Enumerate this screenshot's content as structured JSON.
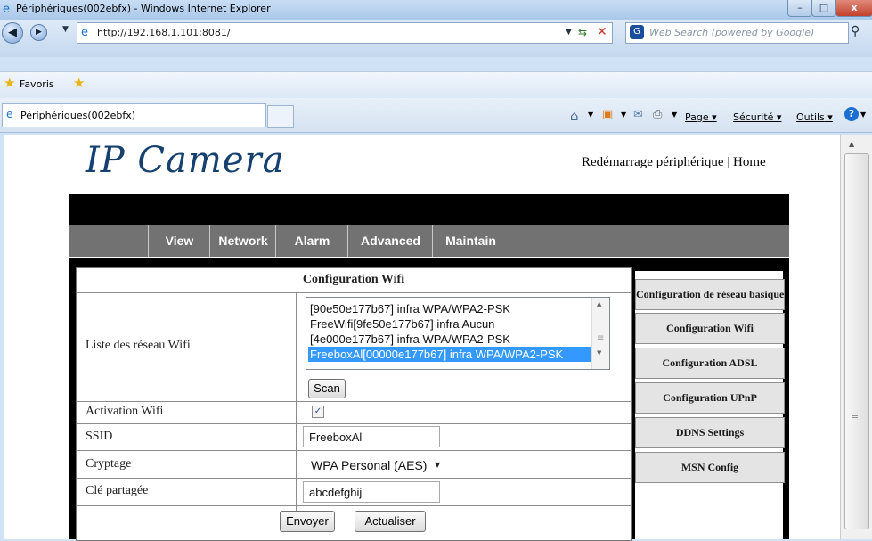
{
  "window": {
    "title": "Périphériques(002ebfx) - Windows Internet Explorer"
  },
  "address": {
    "url": "http://192.168.1.101:8081/"
  },
  "search": {
    "placeholder": "Web Search (powered by Google)"
  },
  "favorites": {
    "label": "Favoris"
  },
  "tab": {
    "label": "Périphériques(002ebfx)"
  },
  "toolbar": {
    "page": "Page",
    "security": "Sécurité",
    "tools": "Outils"
  },
  "page": {
    "logo": "IP Camera",
    "reboot_link": "Redémarrage périphérique",
    "separator": "|",
    "home_link": "Home",
    "nav": [
      "View",
      "Network",
      "Alarm",
      "Advanced",
      "Maintain"
    ]
  },
  "form": {
    "title": "Configuration Wifi",
    "wifi_list_label": "Liste des réseau Wifi",
    "networks": [
      "[90e50e177b67] infra WPA/WPA2-PSK",
      "FreeWifi[9fe50e177b67] infra Aucun",
      "[4e000e177b67] infra WPA/WPA2-PSK",
      "FreeboxAl[00000e177b67] infra WPA/WPA2-PSK"
    ],
    "selected_network_index": 3,
    "scan_label": "Scan",
    "activation_label": "Activation Wifi",
    "activation_checked": true,
    "ssid_label": "SSID",
    "ssid_value": "FreeboxAl",
    "crypt_label": "Cryptage",
    "crypt_value": "WPA Personal (AES)",
    "key_label": "Clé partagée",
    "key_value": "abcdefghij",
    "submit_label": "Envoyer",
    "refresh_label": "Actualiser"
  },
  "sidebar": [
    "Configuration de réseau basique",
    "Configuration Wifi",
    "Configuration ADSL",
    "Configuration UPnP",
    "DDNS Settings",
    "MSN Config"
  ],
  "colors": {
    "brand": "#15406f",
    "nav_bg": "#727272",
    "selection": "#3399ff"
  }
}
